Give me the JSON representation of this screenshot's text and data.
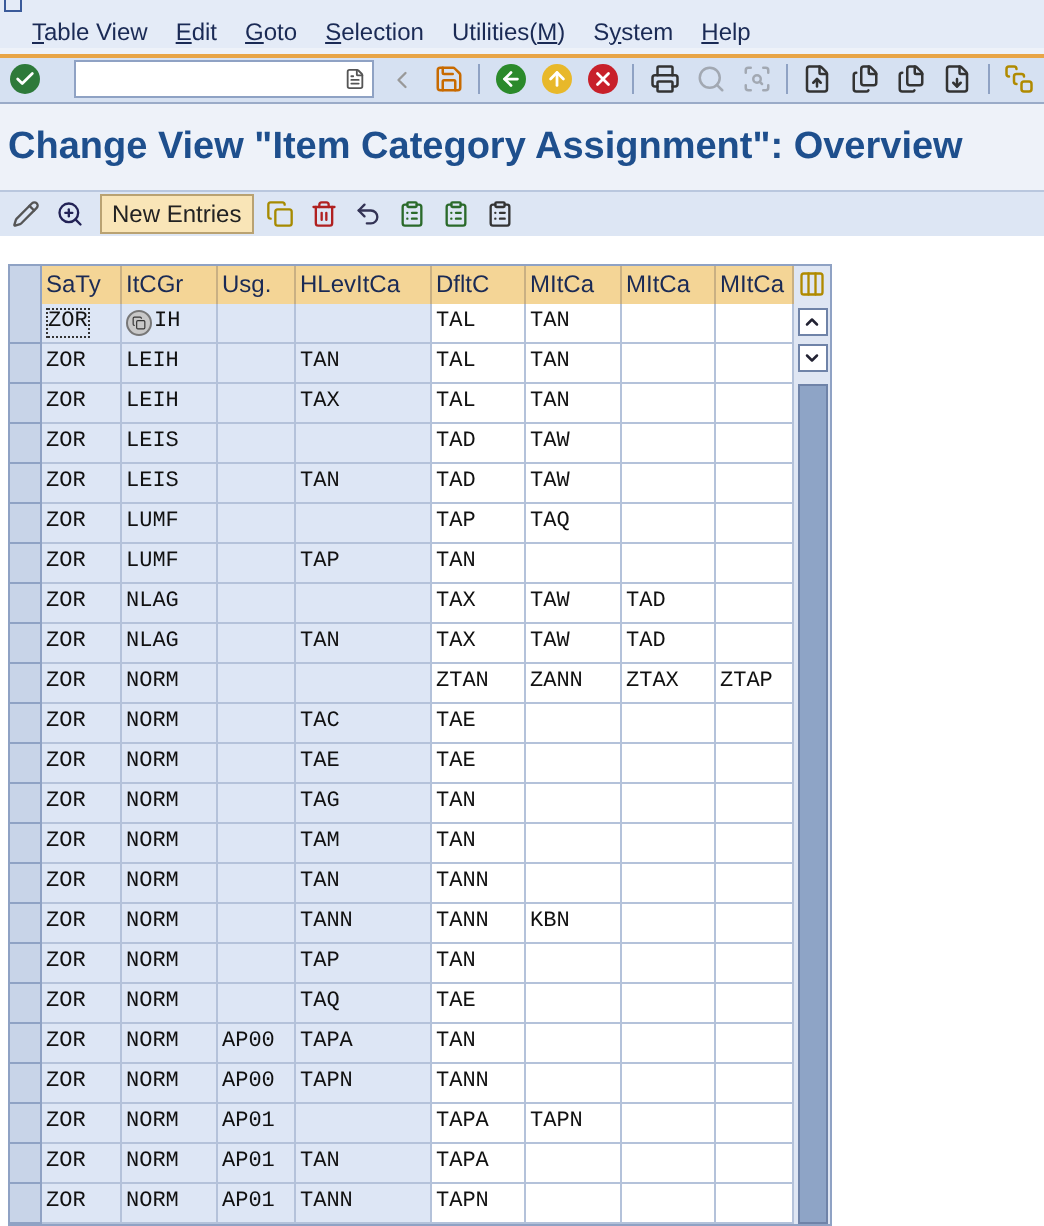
{
  "menu": [
    {
      "parts": [
        {
          "text": "T",
          "underlined": true
        },
        {
          "text": "able View",
          "underlined": false
        }
      ]
    },
    {
      "parts": [
        {
          "text": "E",
          "underlined": true
        },
        {
          "text": "dit",
          "underlined": false
        }
      ]
    },
    {
      "parts": [
        {
          "text": "G",
          "underlined": true
        },
        {
          "text": "oto",
          "underlined": false
        }
      ]
    },
    {
      "parts": [
        {
          "text": "S",
          "underlined": true
        },
        {
          "text": "election",
          "underlined": false
        }
      ]
    },
    {
      "parts": [
        {
          "text": "Utilities(",
          "underlined": false
        },
        {
          "text": "M",
          "underlined": true
        },
        {
          "text": ")",
          "underlined": false
        }
      ]
    },
    {
      "parts": [
        {
          "text": "S",
          "underlined": false
        },
        {
          "text": "y",
          "underlined": true
        },
        {
          "text": "stem",
          "underlined": false
        }
      ]
    },
    {
      "parts": [
        {
          "text": "H",
          "underlined": true
        },
        {
          "text": "elp",
          "underlined": false
        }
      ]
    }
  ],
  "title": "Change View \"Item Category Assignment\": Overview",
  "app_toolbar": {
    "new_entries": "New Entries"
  },
  "table": {
    "columns": [
      {
        "label": "SaTy",
        "kind": "key"
      },
      {
        "label": "ItCGr",
        "kind": "key"
      },
      {
        "label": "Usg.",
        "kind": "key"
      },
      {
        "label": "HLevItCa",
        "kind": "key"
      },
      {
        "label": "DfltC",
        "kind": "data"
      },
      {
        "label": "MItCa",
        "kind": "data"
      },
      {
        "label": "MItCa",
        "kind": "data"
      },
      {
        "label": "MItCa",
        "kind": "data"
      }
    ],
    "rows": [
      {
        "focused": true,
        "pointer": true,
        "cells": [
          "ZOR",
          "IH",
          null,
          null,
          "TAL",
          "TAN",
          null,
          null
        ]
      },
      {
        "focused": false,
        "pointer": false,
        "cells": [
          "ZOR",
          "LEIH",
          null,
          "TAN",
          "TAL",
          "TAN",
          null,
          null
        ]
      },
      {
        "focused": false,
        "pointer": false,
        "cells": [
          "ZOR",
          "LEIH",
          null,
          "TAX",
          "TAL",
          "TAN",
          null,
          null
        ]
      },
      {
        "focused": false,
        "pointer": false,
        "cells": [
          "ZOR",
          "LEIS",
          null,
          null,
          "TAD",
          "TAW",
          null,
          null
        ]
      },
      {
        "focused": false,
        "pointer": false,
        "cells": [
          "ZOR",
          "LEIS",
          null,
          "TAN",
          "TAD",
          "TAW",
          null,
          null
        ]
      },
      {
        "focused": false,
        "pointer": false,
        "cells": [
          "ZOR",
          "LUMF",
          null,
          null,
          "TAP",
          "TAQ",
          null,
          null
        ]
      },
      {
        "focused": false,
        "pointer": false,
        "cells": [
          "ZOR",
          "LUMF",
          null,
          "TAP",
          "TAN",
          null,
          null,
          null
        ]
      },
      {
        "focused": false,
        "pointer": false,
        "cells": [
          "ZOR",
          "NLAG",
          null,
          null,
          "TAX",
          "TAW",
          "TAD",
          null
        ]
      },
      {
        "focused": false,
        "pointer": false,
        "cells": [
          "ZOR",
          "NLAG",
          null,
          "TAN",
          "TAX",
          "TAW",
          "TAD",
          null
        ]
      },
      {
        "focused": false,
        "pointer": false,
        "cells": [
          "ZOR",
          "NORM",
          null,
          null,
          "ZTAN",
          "ZANN",
          "ZTAX",
          "ZTAP"
        ]
      },
      {
        "focused": false,
        "pointer": false,
        "cells": [
          "ZOR",
          "NORM",
          null,
          "TAC",
          "TAE",
          null,
          null,
          null
        ]
      },
      {
        "focused": false,
        "pointer": false,
        "cells": [
          "ZOR",
          "NORM",
          null,
          "TAE",
          "TAE",
          null,
          null,
          null
        ]
      },
      {
        "focused": false,
        "pointer": false,
        "cells": [
          "ZOR",
          "NORM",
          null,
          "TAG",
          "TAN",
          null,
          null,
          null
        ]
      },
      {
        "focused": false,
        "pointer": false,
        "cells": [
          "ZOR",
          "NORM",
          null,
          "TAM",
          "TAN",
          null,
          null,
          null
        ]
      },
      {
        "focused": false,
        "pointer": false,
        "cells": [
          "ZOR",
          "NORM",
          null,
          "TAN",
          "TANN",
          null,
          null,
          null
        ]
      },
      {
        "focused": false,
        "pointer": false,
        "cells": [
          "ZOR",
          "NORM",
          null,
          "TANN",
          "TANN",
          "KBN",
          null,
          null
        ]
      },
      {
        "focused": false,
        "pointer": false,
        "cells": [
          "ZOR",
          "NORM",
          null,
          "TAP",
          "TAN",
          null,
          null,
          null
        ]
      },
      {
        "focused": false,
        "pointer": false,
        "cells": [
          "ZOR",
          "NORM",
          null,
          "TAQ",
          "TAE",
          null,
          null,
          null
        ]
      },
      {
        "focused": false,
        "pointer": false,
        "cells": [
          "ZOR",
          "NORM",
          "AP00",
          "TAPA",
          "TAN",
          null,
          null,
          null
        ]
      },
      {
        "focused": false,
        "pointer": false,
        "cells": [
          "ZOR",
          "NORM",
          "AP00",
          "TAPN",
          "TANN",
          null,
          null,
          null
        ]
      },
      {
        "focused": false,
        "pointer": false,
        "cells": [
          "ZOR",
          "NORM",
          "AP01",
          null,
          "TAPA",
          "TAPN",
          null,
          null
        ]
      },
      {
        "focused": false,
        "pointer": false,
        "cells": [
          "ZOR",
          "NORM",
          "AP01",
          "TAN",
          "TAPA",
          null,
          null,
          null
        ]
      },
      {
        "focused": false,
        "pointer": false,
        "cells": [
          "ZOR",
          "NORM",
          "AP01",
          "TANN",
          "TAPN",
          null,
          null,
          null
        ]
      }
    ]
  }
}
